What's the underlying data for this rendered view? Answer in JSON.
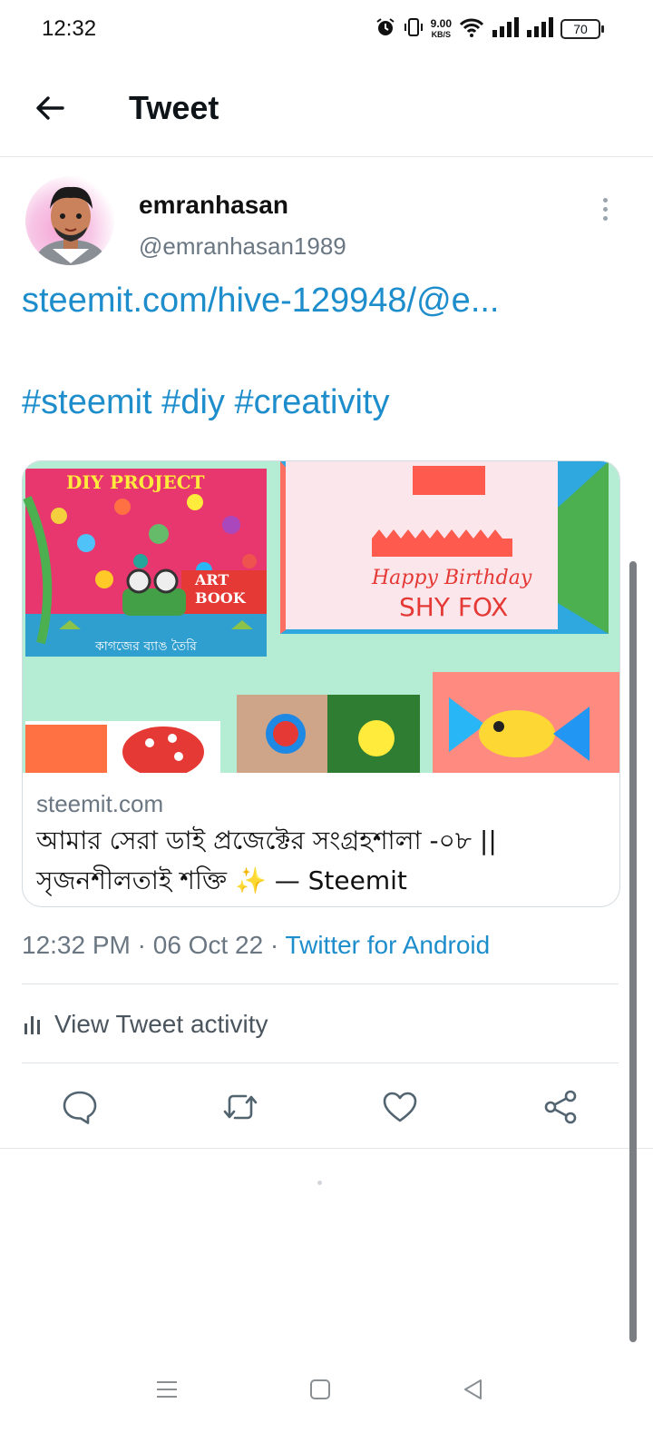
{
  "status_bar": {
    "time": "12:32",
    "net_speed_value": "9.00",
    "net_speed_unit": "KB/S",
    "battery": "70",
    "icons": [
      "alarm-icon",
      "vibrate-icon",
      "wifi-icon",
      "signal-icon",
      "signal-icon",
      "battery-icon"
    ]
  },
  "header": {
    "title": "Tweet",
    "back_icon": "arrow-left-icon"
  },
  "tweet": {
    "display_name": "emranhasan",
    "handle": "@emranhasan1989",
    "link_text": "steemit.com/hive-129948/@e...",
    "hashtags": "#steemit #diy #creativity",
    "more_icon": "more-vertical-icon"
  },
  "card": {
    "domain": "steemit.com",
    "title": "আমার সেরা ডাই প্রজেক্টের সংগ্রহশালা -০৮ || সৃজনশীলতাই শক্তি ✨ — Steemit",
    "image_texts": {
      "diy_label": "DIY PROJECT",
      "art_label": "ART",
      "book_label": "BOOK",
      "bangla_caption": "কাগজের ব্যাঙ তৈরি",
      "happy_birthday": "Happy Birthday",
      "shy_fox": "SHY FOX"
    }
  },
  "meta": {
    "time": "12:32 PM",
    "date": "06 Oct 22",
    "separator": " · ",
    "source": "Twitter for Android"
  },
  "activity": {
    "label": "View Tweet activity",
    "icon": "bar-chart-icon"
  },
  "actions": [
    "reply-icon",
    "retweet-icon",
    "like-icon",
    "share-icon"
  ],
  "colors": {
    "link": "#1d8dcc",
    "secondary_text": "#6a7782",
    "card_bg": "#b5ecd4"
  },
  "nav_bar": [
    "menu-icon",
    "home-square-icon",
    "back-triangle-icon"
  ]
}
